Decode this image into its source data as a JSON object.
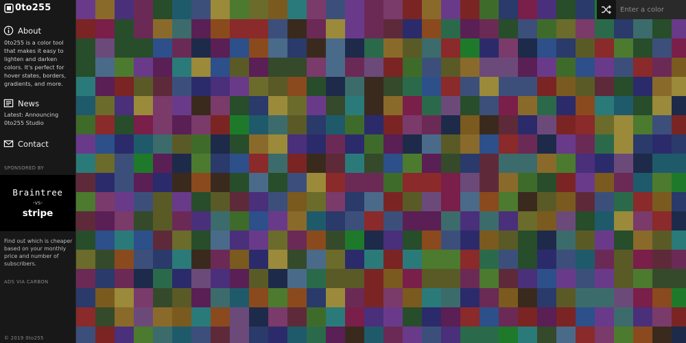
{
  "app": {
    "title": "0to255"
  },
  "sidebar": {
    "about": {
      "heading": "About",
      "text": "0to255 is a color tool that makes it easy to lighten and darken colors. It's perfect for hover states, borders, gradients, and more."
    },
    "news": {
      "heading": "News",
      "text": "Latest: Announcing 0to255 Studio"
    },
    "contact": {
      "heading": "Contact"
    },
    "sponsor_label": "SPONSORED BY",
    "ad": {
      "brand_top": "Braintree",
      "vs": "-vs-",
      "brand_bottom": "stripe",
      "text": "Find out which is cheaper based on your monthly price and number of subscribers.",
      "via": "ADS VIA CARBON"
    },
    "footer": "© 2019 0to255"
  },
  "toolbar": {
    "search_placeholder": "Enter a color",
    "shuffle_icon": "shuffle-icon"
  },
  "colors": {
    "grid_columns": 32,
    "grid_rows": 18,
    "palette": [
      "#5a5a27",
      "#3f6b2a",
      "#3c4f7a",
      "#4a2f7b",
      "#5a1f54",
      "#7b2424",
      "#1e7a2a",
      "#6b2a55",
      "#2d4f8a",
      "#7a5a1e",
      "#3c6b6b",
      "#8a2a2a",
      "#2b2b6b",
      "#6b6b2b",
      "#274d2a",
      "#6a3a8a",
      "#1f5a6b",
      "#8a6a2a",
      "#4c7a2f",
      "#5e2a3a",
      "#2a6a4a",
      "#7a3a6a",
      "#354a2a",
      "#1e2a4a",
      "#8a4a1e",
      "#2a7a7a",
      "#6b4a7a",
      "#4a6a8a",
      "#9a8a3a",
      "#3a2a1e",
      "#2a3a6a",
      "#7a1e4a"
    ]
  }
}
